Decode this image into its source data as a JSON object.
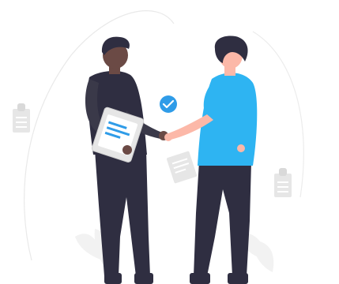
{
  "illustration": {
    "icons": {
      "check": "check-circle-icon",
      "clipboard": "clipboard-icon",
      "document": "document-icon"
    },
    "colors": {
      "accent": "#2f9ce8",
      "shirt_blue": "#2eb4f2",
      "dark_clothing": "#2f2e41",
      "skin_dark": "#6b4a45",
      "skin_light": "#fcb8a8",
      "hair": "#2f2e41",
      "decor_gray": "#e6e6e6"
    }
  }
}
